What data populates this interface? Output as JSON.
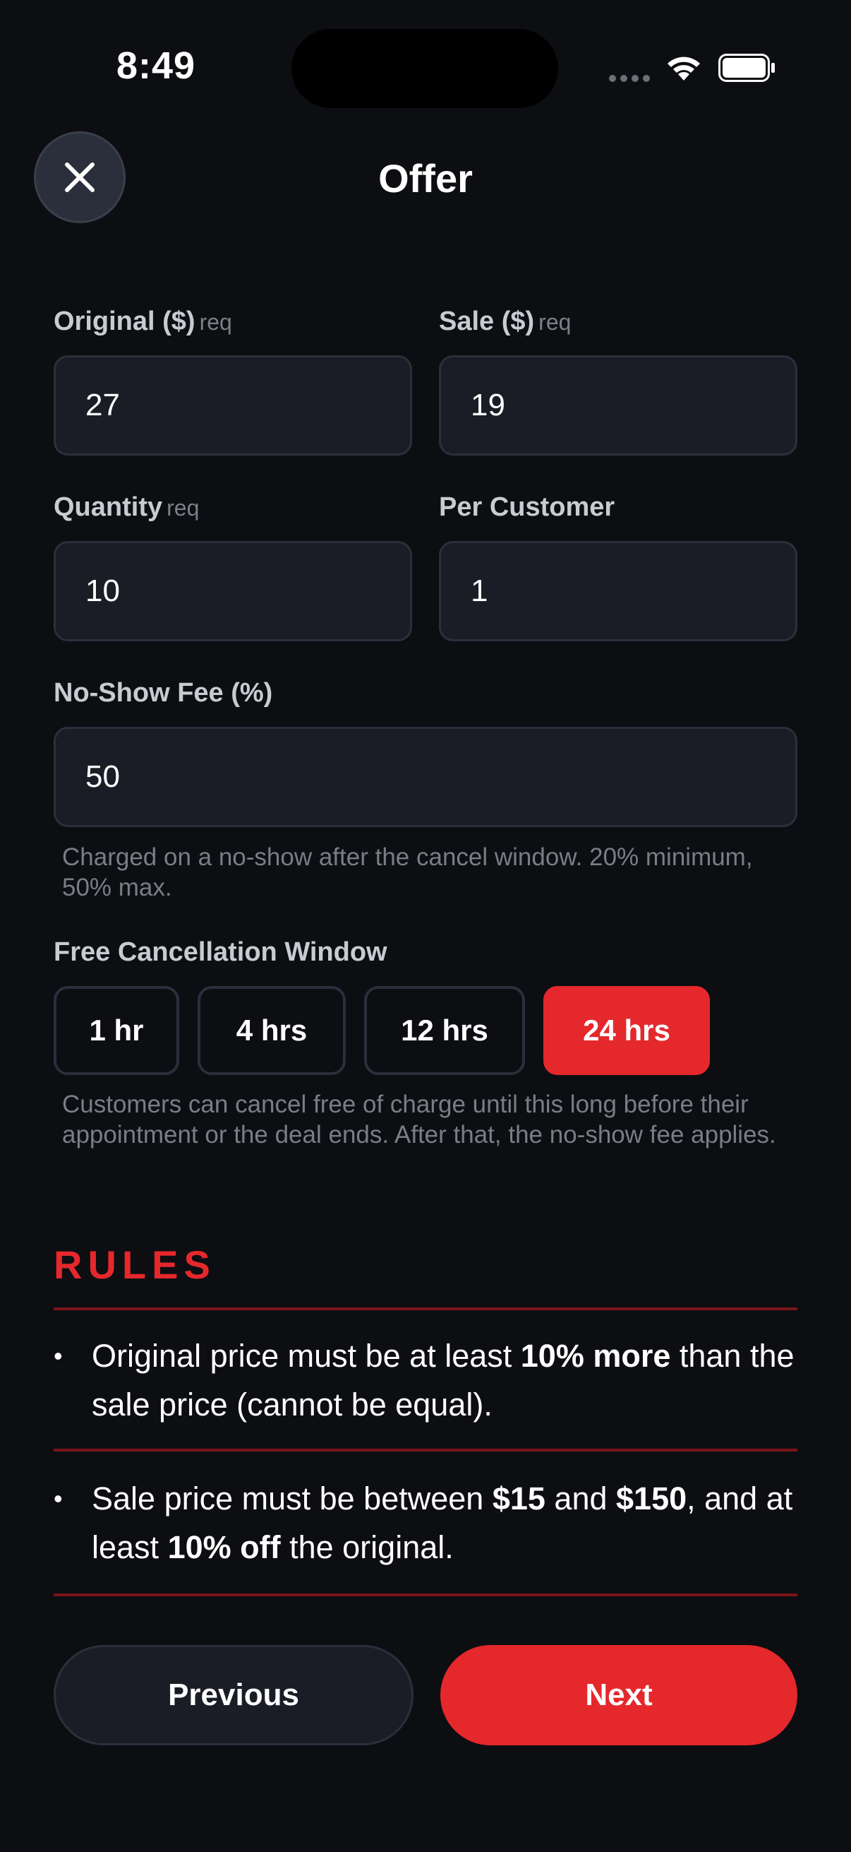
{
  "status_bar": {
    "time": "8:49"
  },
  "header": {
    "title": "Offer",
    "close_icon": "close-icon"
  },
  "fields": {
    "original": {
      "label": "Original ($)",
      "req": "req",
      "value": "27"
    },
    "sale": {
      "label": "Sale ($)",
      "req": "req",
      "value": "19"
    },
    "quantity": {
      "label": "Quantity",
      "req": "req",
      "value": "10"
    },
    "per_customer": {
      "label": "Per Customer",
      "value": "1"
    },
    "no_show_fee": {
      "label": "No-Show Fee (%)",
      "value": "50",
      "help": "Charged on a no-show after the cancel window. 20% minimum, 50% max."
    }
  },
  "cancellation": {
    "label": "Free Cancellation Window",
    "options": [
      "1 hr",
      "4 hrs",
      "12 hrs",
      "24 hrs"
    ],
    "selected": "24 hrs",
    "help": "Customers can cancel free of charge until this long before their appointment or the deal ends. After that, the no-show fee applies."
  },
  "rules": {
    "heading": "RULES",
    "bullet": "•",
    "items": [
      {
        "t1": "Original price must be at least ",
        "b1": "10% more",
        "t2": " than the sale price (cannot be equal)."
      },
      {
        "t1": "Sale price must be between ",
        "b1": "$15",
        "t2": " and ",
        "b2": "$150",
        "t3": ", and at least ",
        "b3": "10% off",
        "t4": " the original."
      }
    ]
  },
  "footer": {
    "previous_label": "Previous",
    "next_label": "Next"
  },
  "colors": {
    "background": "#0d0e12",
    "accent": "#e5282c",
    "input_bg": "#1b1d26",
    "divider": "#7a1519"
  }
}
